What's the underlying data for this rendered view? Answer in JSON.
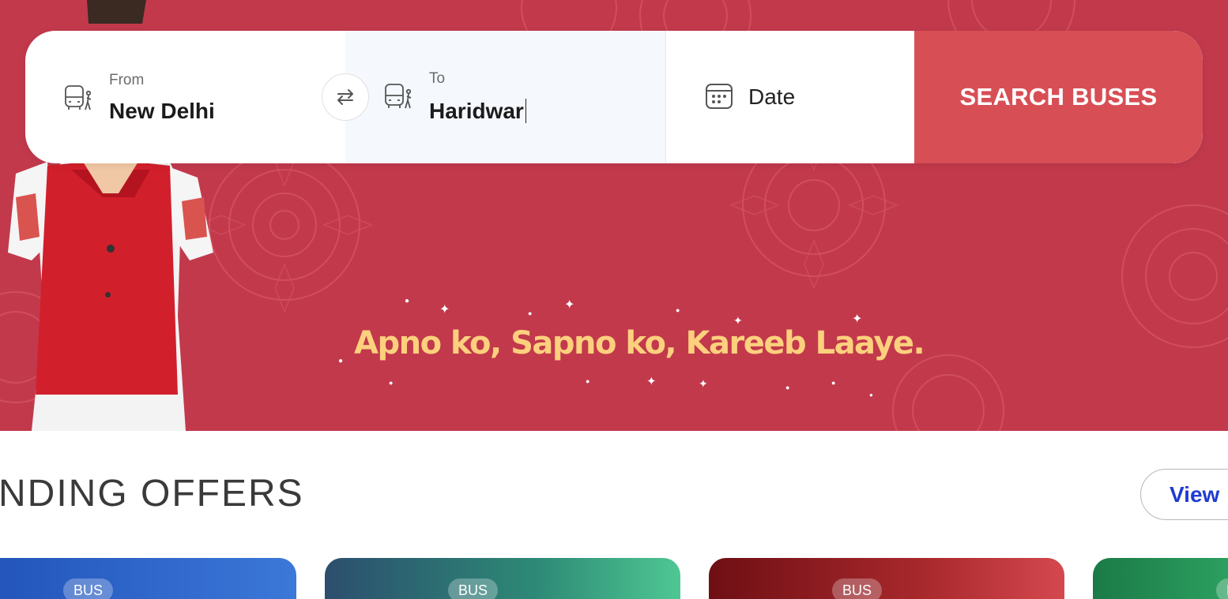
{
  "search": {
    "from_label": "From",
    "from_value": "New Delhi",
    "to_label": "To",
    "to_value": "Haridwar",
    "date_label": "Date",
    "search_button": "SEARCH BUSES"
  },
  "banner": {
    "tagline": "Apno ko, Sapno ko, Kareeb Laaye."
  },
  "offers": {
    "title": "ENDING OFFERS",
    "view_button": "View",
    "cards": [
      {
        "badge": "BUS"
      },
      {
        "badge": "BUS"
      },
      {
        "badge": "BUS"
      },
      {
        "badge": "B"
      }
    ]
  },
  "colors": {
    "banner_bg": "#c2394c",
    "search_button_bg": "#d84e55",
    "tagline": "#fcd07d",
    "link_blue": "#1f3bd2"
  },
  "icons": [
    "bus-stop-icon",
    "swap-icon",
    "calendar-icon"
  ]
}
